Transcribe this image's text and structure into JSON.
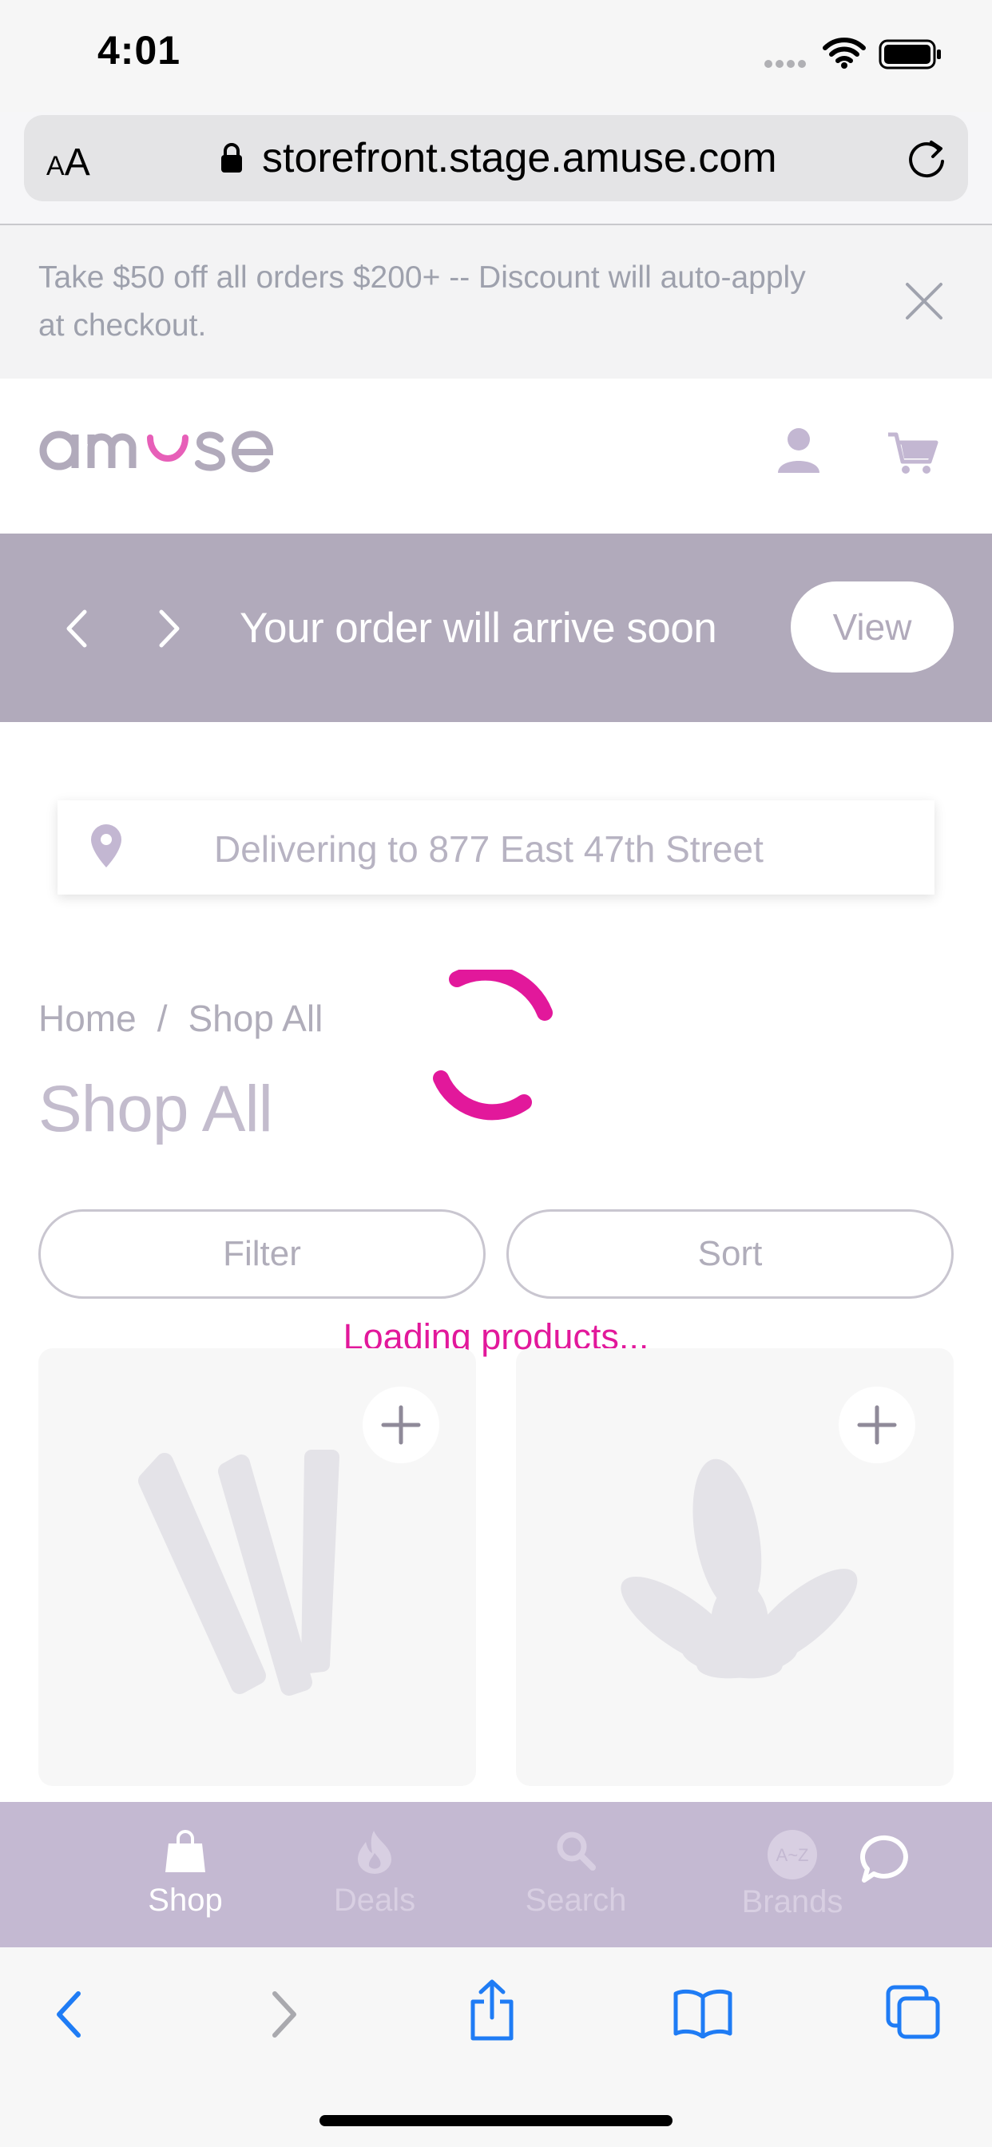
{
  "status_bar": {
    "time": "4:01"
  },
  "browser": {
    "text_size_label_small": "A",
    "text_size_label_large": "A",
    "url": "storefront.stage.amuse.com"
  },
  "promo": {
    "text": "Take $50 off all orders $200+ -- Discount will auto-apply at checkout."
  },
  "header": {
    "logo_text": "amuse"
  },
  "order_banner": {
    "text": "Your order will arrive soon",
    "view_label": "View"
  },
  "delivery": {
    "text": "Delivering to 877 East 47th Street"
  },
  "breadcrumb": {
    "home": "Home",
    "separator": "/",
    "current": "Shop All"
  },
  "page": {
    "title": "Shop All"
  },
  "controls": {
    "filter_label": "Filter",
    "sort_label": "Sort"
  },
  "loading": {
    "text": "Loading products..."
  },
  "products": [
    {
      "image": "cones-icon"
    },
    {
      "image": "leaf-icon"
    }
  ],
  "app_nav": {
    "items": [
      {
        "label": "Shop",
        "icon": "bag-icon",
        "active": true
      },
      {
        "label": "Deals",
        "icon": "flame-icon",
        "active": false
      },
      {
        "label": "Search",
        "icon": "search-icon",
        "active": false
      },
      {
        "label": "Brands",
        "icon": "brands-icon",
        "active": false,
        "badge": "A~Z"
      }
    ]
  },
  "colors": {
    "accent": "#e2189b",
    "banner": "#b1aabb",
    "nav": "#c4b9d2",
    "ios_blue": "#1f7cf5"
  }
}
